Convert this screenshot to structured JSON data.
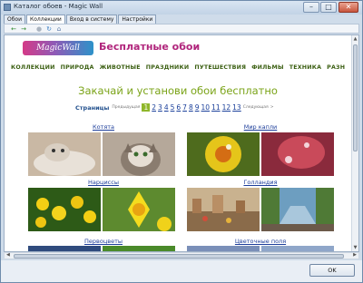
{
  "window": {
    "title": "Каталог обоев - Magic Wall"
  },
  "tabs": [
    "Обои",
    "Коллекции",
    "Вход в систему",
    "Настройки"
  ],
  "site": {
    "logo_text": "MagicWall",
    "title": "Бесплатные обои",
    "nav": [
      "КОЛЛЕКЦИИ",
      "ПРИРОДА",
      "ЖИВОТНЫЕ",
      "ПРАЗДНИКИ",
      "ПУТЕШЕСТВИЯ",
      "ФИЛЬМЫ",
      "ТЕХНИКА",
      "РАЗН"
    ],
    "headline": "Закачай и установи обои бесплатно",
    "pager": {
      "label": "Страницы",
      "prev": "Предыдущая",
      "pages": [
        "1",
        "2",
        "3",
        "4",
        "5",
        "6",
        "7",
        "8",
        "9",
        "10",
        "11",
        "12",
        "13"
      ],
      "current": "1",
      "next": "Следующая",
      "next_arrow": ">"
    },
    "categories": [
      "Котята",
      "Мир капли",
      "Нарциссы",
      "Голландия",
      "Первоцветы",
      "Цветочные поля"
    ]
  },
  "footer": {
    "ok_label": "OK"
  },
  "colors": {
    "brand_pink": "#b0247b",
    "nav_green": "#3b5f12",
    "headline_green": "#7aa317",
    "link_blue": "#1e3f9b"
  }
}
